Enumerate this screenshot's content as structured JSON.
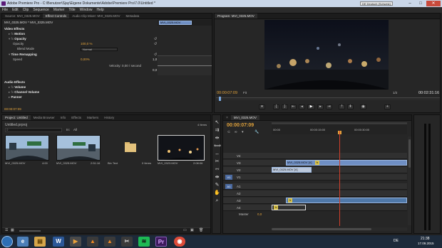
{
  "window": {
    "title": "Adobe Premiere Pro - C:\\Benutzer\\Sjay\\Eigene Dokumente\\Adobe\\Premiere Pro\\7.0\\Untitled *",
    "lang_badge": "DE Deutsch (Schweiz)",
    "min": "–",
    "max": "□",
    "close": "✕"
  },
  "menu": [
    "File",
    "Edit",
    "Clip",
    "Sequence",
    "Marker",
    "Title",
    "Window",
    "Help"
  ],
  "source_tabs": [
    "Source: MVI_0325.MOV",
    "Effect Controls",
    "Audio Clip Mixer: MVI_0325.MOV",
    "Metadata"
  ],
  "effects": {
    "clip_path": "MVI_0325.MOV * MVI_0325.MOV",
    "timeline_clip": "MVI_0325.MOV",
    "video_effects": "Video Effects",
    "motion": "Motion",
    "opacity": "Opacity",
    "opacity_label": "Opacity",
    "opacity_value": "100,0 %",
    "blend_mode_label": "Blend Mode",
    "blend_mode_value": "Normal",
    "time_remapping": "Time Remapping",
    "speed_label": "Speed",
    "speed_value": "0,00%",
    "velocity": "Velocity: 0,00 / second",
    "velocity_vals": [
      "1,0",
      "0,0"
    ],
    "audio_effects": "Audio Effects",
    "volume": "Volume",
    "channel_volume": "Channel Volume",
    "panner": "Panner",
    "timecode": "00:00:07:09"
  },
  "program": {
    "tab": "Program: MVI_0325.MOV",
    "timecode": "00:00:07:09",
    "fit": "Fit",
    "quality": "1/2",
    "duration": "00:02:31:16"
  },
  "project": {
    "tabs": [
      "Project: Untitled",
      "Media Browser",
      "Info",
      "Effects",
      "Markers",
      "History"
    ],
    "file": "Untitled.prproj",
    "in_label": "In:",
    "in_value": "All",
    "items_count": "4 Items",
    "items": [
      {
        "name": "MVI_0325.MOV",
        "dur": "4:00"
      },
      {
        "name": "MVI_0325.MOV",
        "dur": "2:51:16"
      },
      {
        "name": "Bin Text",
        "dur": "0 Items"
      },
      {
        "name": "MVI_0323.MOV",
        "dur": "2:08:06"
      }
    ]
  },
  "timeline": {
    "tab": "MVI_0325.MOV",
    "timecode": "00:00:07:09",
    "ruler": [
      "00:00",
      "00:00:15:00",
      "00:00:30:00"
    ],
    "video_tracks": [
      "V4",
      "V3",
      "V2",
      "V1"
    ],
    "audio_tracks": [
      "A1",
      "A2",
      "A3",
      "A4"
    ],
    "master_label": "Master",
    "master_value": "0,0",
    "clip_v3": "MVI_0325.MOV [V]",
    "clip_v2": "MVI_0325.MOV [V]",
    "fx_badge": "fx",
    "track_src": [
      "V1",
      "A1"
    ]
  },
  "taskbar": {
    "time": "21:38",
    "date": "17.09.2015",
    "lang": "DE"
  },
  "colors": {
    "accent": "#e2a33b",
    "clip": "#6f8fc4",
    "playhead": "#d1402b"
  }
}
